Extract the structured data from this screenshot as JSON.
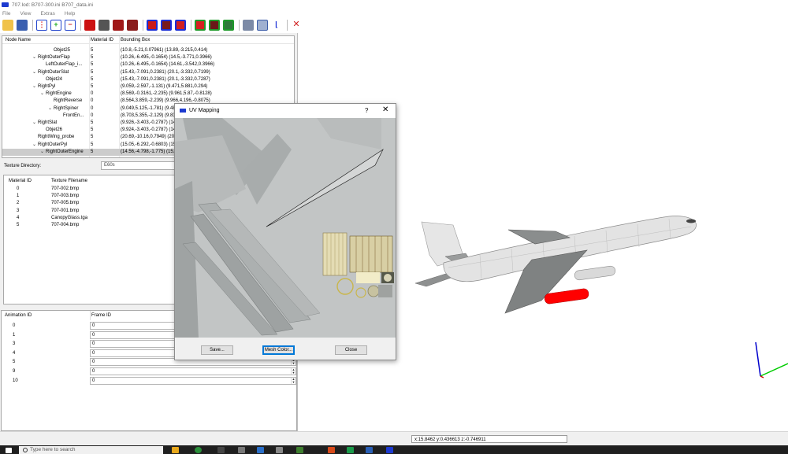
{
  "window": {
    "title": "707.lod: B707-300.ini  B707_data.ini"
  },
  "menu": [
    "File",
    "View",
    "Extras",
    "Help"
  ],
  "tree": {
    "columns": [
      "Node Name",
      "Material ID",
      "Bounding Box"
    ],
    "rows": [
      {
        "name": "Objet25",
        "level": 5,
        "expander": "",
        "mat": "5",
        "bbox": "(10.8,-5.21,0.07961) (13.89,-3.215,0.414)"
      },
      {
        "name": "RightOuterFlap",
        "level": 3,
        "expander": "v",
        "mat": "5",
        "bbox": "(10.26,-6.495,-0.1654) (14.5,-3.771,0.3966)"
      },
      {
        "name": "LeftOuterFlap_i...",
        "level": 4,
        "expander": "",
        "mat": "5",
        "bbox": "(10.26,-6.495,-0.1654) (14.61,-3.542,0.3966)"
      },
      {
        "name": "RightOuterSlat",
        "level": 3,
        "expander": "v",
        "mat": "5",
        "bbox": "(15.43,-7.091,0.2381) (20.1,-3.332,0.7199)"
      },
      {
        "name": "Objet24",
        "level": 4,
        "expander": "",
        "mat": "5",
        "bbox": "(15.43,-7.091,0.2381) (20.1,-3.332,0.7287)"
      },
      {
        "name": "RightPyl",
        "level": 3,
        "expander": "v",
        "mat": "5",
        "bbox": "(9.059,-2.597,-1.131) (9.471,5.881,0.294)"
      },
      {
        "name": "RightEngine",
        "level": 4,
        "expander": "v",
        "mat": "0",
        "bbox": "(8.569,-0.3161,-2.235) (9.961,5.87,-0.8128)"
      },
      {
        "name": "RightReverse",
        "level": 5,
        "expander": "",
        "mat": "0",
        "bbox": "(8.564,3.859,-2.239) (9.966,4.196,-0.8075)"
      },
      {
        "name": "RightSpiner",
        "level": 5,
        "expander": "v",
        "mat": "0",
        "bbox": "(9.049,5.125,-1.781) (9.48..."
      },
      {
        "name": "FrontEn...",
        "level": 6,
        "expander": "",
        "mat": "0",
        "bbox": "(8.703,5.355,-2.129) (9.83..."
      },
      {
        "name": "RightSlat",
        "level": 3,
        "expander": "v",
        "mat": "5",
        "bbox": "(9.926,-3.403,-0.2787) (14..."
      },
      {
        "name": "Objet26",
        "level": 4,
        "expander": "",
        "mat": "5",
        "bbox": "(9.924,-3.403,-0.2787) (14..."
      },
      {
        "name": "RightWing_probe",
        "level": 3,
        "expander": "",
        "mat": "5",
        "bbox": "(20.69,-10.16,0.7949) (20..."
      },
      {
        "name": "RightOuterPyl",
        "level": 3,
        "expander": "v",
        "mat": "5",
        "bbox": "(15.05,-6.292,-0.6803) (15..."
      },
      {
        "name": "RightOuterEngine",
        "level": 4,
        "expander": "v",
        "mat": "5",
        "bbox": "(14.56,-4.798,-1.775) (15...",
        "selected": true
      }
    ]
  },
  "texture_directory": {
    "label": "Texture Directory:",
    "value": "E60s"
  },
  "textures": {
    "columns": [
      "Material ID",
      "Texture Filename"
    ],
    "rows": [
      {
        "id": "0",
        "file": "707-002.bmp"
      },
      {
        "id": "1",
        "file": "707-003.bmp"
      },
      {
        "id": "2",
        "file": "707-005.bmp"
      },
      {
        "id": "3",
        "file": "707-001.bmp"
      },
      {
        "id": "4",
        "file": "CanopyGlass.tga"
      },
      {
        "id": "5",
        "file": "707-004.bmp"
      }
    ]
  },
  "animation": {
    "columns": [
      "Animation ID",
      "Frame ID"
    ],
    "rows": [
      {
        "id": "0",
        "frame": "0"
      },
      {
        "id": "1",
        "frame": "0"
      },
      {
        "id": "3",
        "frame": "0"
      },
      {
        "id": "4",
        "frame": "0"
      },
      {
        "id": "5",
        "frame": "0"
      },
      {
        "id": "9",
        "frame": "0"
      },
      {
        "id": "10",
        "frame": "0"
      }
    ]
  },
  "dialog": {
    "title": "UV Mapping",
    "help": "?",
    "close": "✕",
    "buttons": {
      "save": "Save...",
      "mesh_color": "Mesh Color...",
      "close": "Close"
    }
  },
  "status": {
    "coords": "x:15.8462 y:0.436613 z:-0.746911"
  },
  "taskbar": {
    "search_placeholder": "Type here to search"
  },
  "colors": {
    "accent": "#1c3ad0",
    "engine_highlight": "#ff0000",
    "axis_x": "#00cc00",
    "axis_y": "#0000cc"
  }
}
